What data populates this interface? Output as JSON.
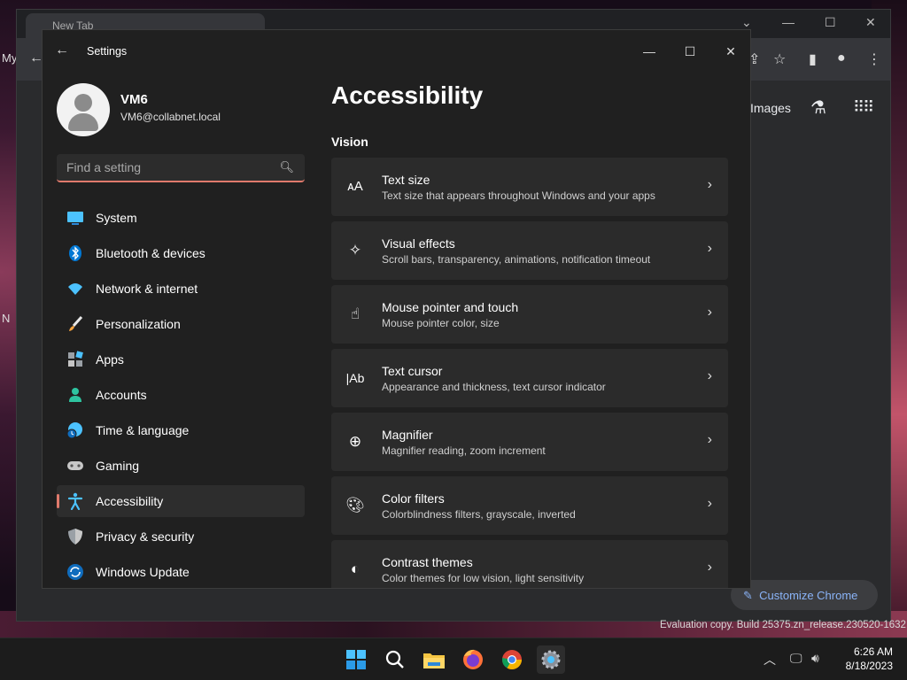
{
  "chrome": {
    "tab_title": "New Tab",
    "images_link": "Images",
    "customize_label": "Customize Chrome",
    "left_peek_top": "My",
    "left_peek_mid": "N"
  },
  "settings": {
    "app_title": "Settings",
    "user": {
      "name": "VM6",
      "email": "VM6@collabnet.local"
    },
    "search": {
      "placeholder": "Find a setting"
    },
    "nav": [
      {
        "label": "System",
        "icon": "system-icon"
      },
      {
        "label": "Bluetooth & devices",
        "icon": "bluetooth-icon"
      },
      {
        "label": "Network & internet",
        "icon": "wifi-icon"
      },
      {
        "label": "Personalization",
        "icon": "brush-icon"
      },
      {
        "label": "Apps",
        "icon": "apps-icon"
      },
      {
        "label": "Accounts",
        "icon": "person-icon"
      },
      {
        "label": "Time & language",
        "icon": "globe-clock-icon"
      },
      {
        "label": "Gaming",
        "icon": "gamepad-icon"
      },
      {
        "label": "Accessibility",
        "icon": "accessibility-icon",
        "active": true
      },
      {
        "label": "Privacy & security",
        "icon": "shield-icon"
      },
      {
        "label": "Windows Update",
        "icon": "update-icon"
      }
    ],
    "page_title": "Accessibility",
    "section_label": "Vision",
    "cards": [
      {
        "title": "Text size",
        "desc": "Text size that appears throughout Windows and your apps",
        "icon": "text-size-icon"
      },
      {
        "title": "Visual effects",
        "desc": "Scroll bars, transparency, animations, notification timeout",
        "icon": "sparkle-icon"
      },
      {
        "title": "Mouse pointer and touch",
        "desc": "Mouse pointer color, size",
        "icon": "pointer-touch-icon"
      },
      {
        "title": "Text cursor",
        "desc": "Appearance and thickness, text cursor indicator",
        "icon": "text-cursor-icon"
      },
      {
        "title": "Magnifier",
        "desc": "Magnifier reading, zoom increment",
        "icon": "magnifier-icon"
      },
      {
        "title": "Color filters",
        "desc": "Colorblindness filters, grayscale, inverted",
        "icon": "palette-icon"
      },
      {
        "title": "Contrast themes",
        "desc": "Color themes for low vision, light sensitivity",
        "icon": "contrast-icon"
      }
    ]
  },
  "taskbar": {
    "time": "6:26 AM",
    "date": "8/18/2023",
    "watermark": "Evaluation copy. Build 25375.zn_release.230520-1632"
  },
  "colors": {
    "accent": "#e07a6c",
    "window_bg": "#202020",
    "card_bg": "#2b2b2b"
  }
}
